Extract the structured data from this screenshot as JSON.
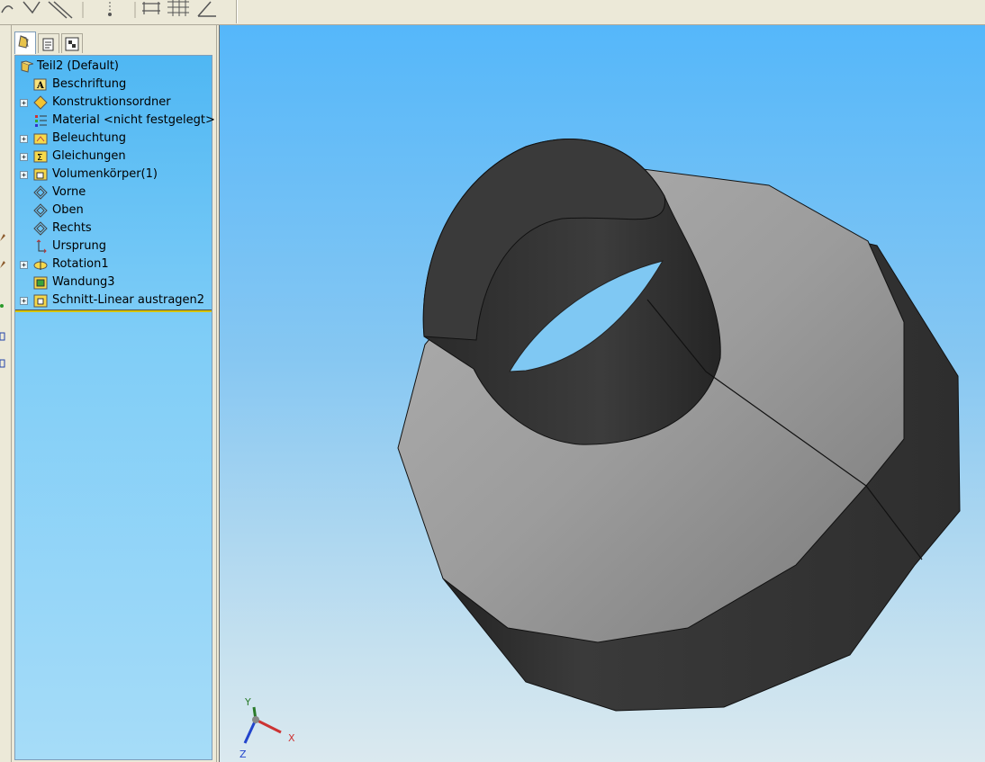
{
  "feature_manager": {
    "tabs": [
      {
        "name": "FeatureManager"
      },
      {
        "name": "PropertyManager"
      },
      {
        "name": "ConfigurationManager"
      }
    ],
    "root": {
      "label": "Teil2  (Default)"
    },
    "items": [
      {
        "label": "Beschriftung",
        "icon": "annotation-icon",
        "expandable": false
      },
      {
        "label": "Konstruktionsordner",
        "icon": "design-binder-icon",
        "expandable": true
      },
      {
        "label": "Material <nicht festgelegt>",
        "icon": "material-icon",
        "expandable": false
      },
      {
        "label": "Beleuchtung",
        "icon": "lighting-icon",
        "expandable": true
      },
      {
        "label": "Gleichungen",
        "icon": "equations-icon",
        "expandable": true
      },
      {
        "label": "Volumenkörper(1)",
        "icon": "solid-bodies-icon",
        "expandable": true
      },
      {
        "label": "Vorne",
        "icon": "plane-icon",
        "expandable": false
      },
      {
        "label": "Oben",
        "icon": "plane-icon",
        "expandable": false
      },
      {
        "label": "Rechts",
        "icon": "plane-icon",
        "expandable": false
      },
      {
        "label": "Ursprung",
        "icon": "origin-icon",
        "expandable": false
      },
      {
        "label": "Rotation1",
        "icon": "revolve-icon",
        "expandable": true
      },
      {
        "label": "Wandung3",
        "icon": "shell-icon",
        "expandable": false
      },
      {
        "label": "Schnitt-Linear austragen2",
        "icon": "cut-extrude-icon",
        "expandable": true
      }
    ]
  },
  "triad": {
    "x": "X",
    "y": "Y",
    "z": "Z"
  },
  "colors": {
    "viewport_top": "#55b7fa",
    "viewport_bottom": "#dbe9ef",
    "tree_bg": "#4fb7f3",
    "rollback_bar": "#d6c300",
    "model_light": "#9a9a9a",
    "model_dark": "#333333"
  }
}
